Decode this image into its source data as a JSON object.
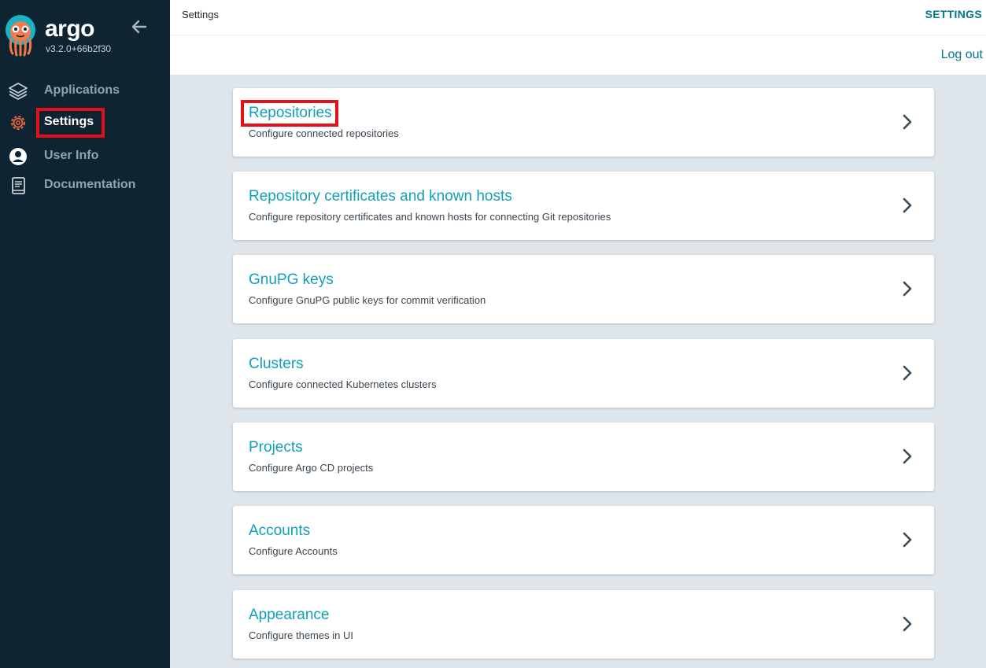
{
  "sidebar": {
    "brand": "argo",
    "version": "v3.2.0+66b2f30",
    "items": [
      {
        "label": "Applications",
        "icon": "layers-icon"
      },
      {
        "label": "Settings",
        "icon": "gear-icon"
      },
      {
        "label": "User Info",
        "icon": "user-circle-icon"
      },
      {
        "label": "Documentation",
        "icon": "book-icon"
      }
    ]
  },
  "header": {
    "breadcrumb": "Settings",
    "title": "SETTINGS",
    "logout": "Log out"
  },
  "cards": [
    {
      "title": "Repositories",
      "description": "Configure connected repositories"
    },
    {
      "title": "Repository certificates and known hosts",
      "description": "Configure repository certificates and known hosts for connecting Git repositories"
    },
    {
      "title": "GnuPG keys",
      "description": "Configure GnuPG public keys for commit verification"
    },
    {
      "title": "Clusters",
      "description": "Configure connected Kubernetes clusters"
    },
    {
      "title": "Projects",
      "description": "Configure Argo CD projects"
    },
    {
      "title": "Accounts",
      "description": "Configure Accounts"
    },
    {
      "title": "Appearance",
      "description": "Configure themes in UI"
    }
  ],
  "colors": {
    "sidebar_bg": "#0e2433",
    "accent": "#00788d",
    "card_title": "#11a0b9",
    "highlight": "#e3101c"
  }
}
